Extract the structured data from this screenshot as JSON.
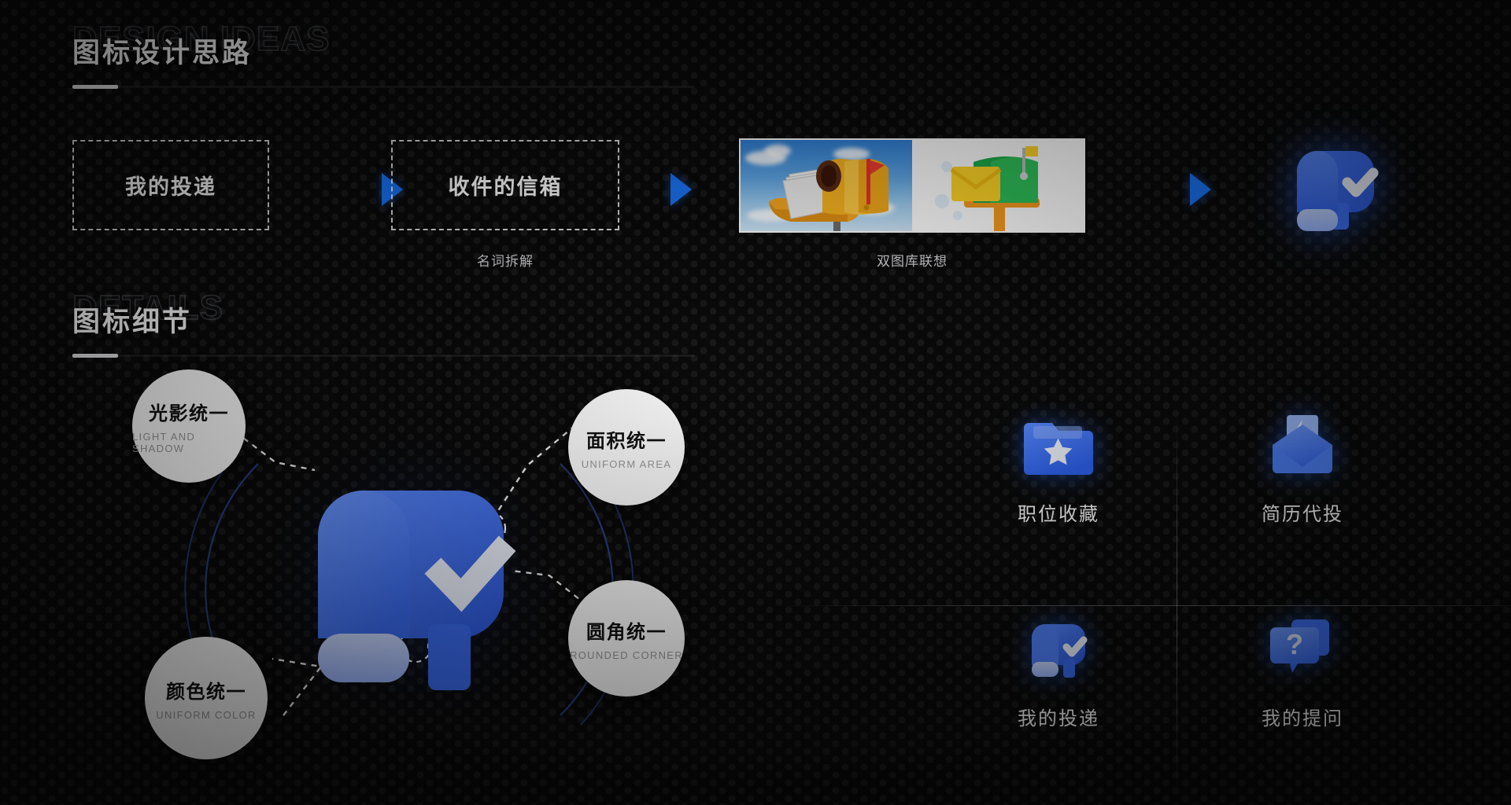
{
  "sections": [
    {
      "ghost_title": "DESIGN IDEAS",
      "cn_title": "图标设计思路"
    },
    {
      "ghost_title": "DETAILS",
      "cn_title": "图标细节"
    }
  ],
  "ideas": {
    "steps": [
      {
        "label": "我的投递",
        "caption": ""
      },
      {
        "label": "收件的信箱",
        "caption": "名词拆解"
      }
    ],
    "arrow_color": "#1a73f5",
    "reference_caption": "双图库联想",
    "reference_images": [
      {
        "name": "photo-mailbox-yellow",
        "alt": "黄色信箱实拍"
      },
      {
        "name": "flat-mailbox-green",
        "alt": "绿色信箱扁平插画"
      }
    ],
    "result_icon": "mailbox-check-icon"
  },
  "details": {
    "annotations": [
      {
        "cn": "光影统一",
        "en": "LIGHT AND SHADOW"
      },
      {
        "cn": "面积统一",
        "en": "UNIFORM AREA"
      },
      {
        "cn": "颜色统一",
        "en": "UNIFORM COLOR"
      },
      {
        "cn": "圆角统一",
        "en": "ROUNDED CORNER"
      }
    ],
    "center_icon": "mailbox-check-icon"
  },
  "icon_grid": {
    "items": [
      {
        "label": "职位收藏",
        "icon": "folder-star-icon"
      },
      {
        "label": "简历代投",
        "icon": "envelope-bolt-icon"
      },
      {
        "label": "我的投递",
        "icon": "mailbox-check-icon"
      },
      {
        "label": "我的提问",
        "icon": "chat-question-icon"
      }
    ]
  },
  "colors": {
    "background": "#090909",
    "accent_blue": "#2f6dfb",
    "accent_blue_light": "#6f9dff",
    "text_primary": "#ffffff"
  }
}
